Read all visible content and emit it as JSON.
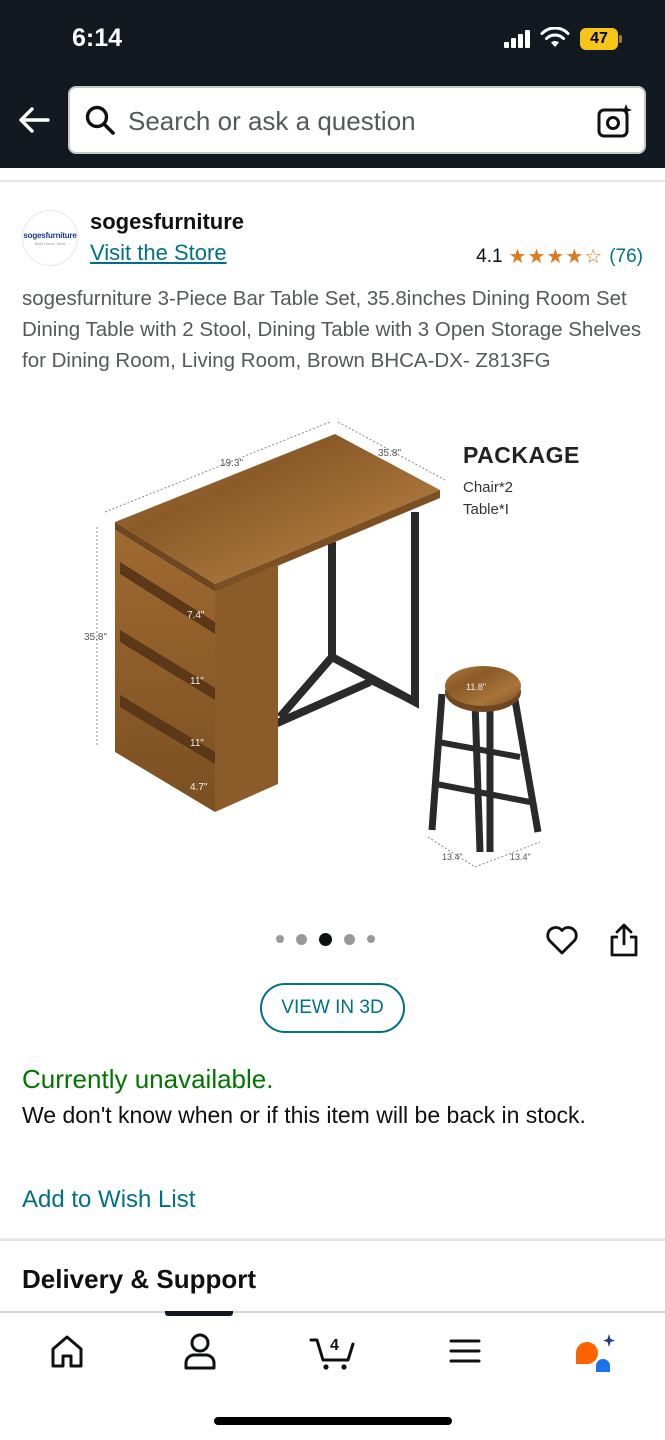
{
  "status_bar": {
    "time": "6:14",
    "battery": "47"
  },
  "search": {
    "placeholder": "Search or ask a question"
  },
  "brand": {
    "logo_text": "sogesfurniture",
    "logo_tagline": "Best Home, Best",
    "name": "sogesfurniture",
    "visit_store": "Visit the Store"
  },
  "rating": {
    "value": "4.1",
    "stars": "★★★★☆",
    "count": "(76)",
    "star_color": "#de7921"
  },
  "product": {
    "title": "sogesfurniture 3-Piece Bar Table Set, 35.8inches Dining Room Set Dining Table with 2 Stool, Dining Table with 3 Open Storage Shelves for Dining Room, Living Room, Brown BHCA-DX- Z813FG"
  },
  "image_labels": {
    "package_title": "PACKAGE",
    "package_line1": "Chair*2",
    "package_line2": "Table*I",
    "dims": {
      "width": "19.3\"",
      "depth": "35.8\"",
      "height": "35.8\"",
      "shelf1": "7.4\"",
      "shelf2": "11\"",
      "shelf3": "11\"",
      "base": "4.7\"",
      "stool_top": "11.8\"",
      "stool_w1": "13.4\"",
      "stool_w2": "13.4\""
    }
  },
  "carousel": {
    "total": 5,
    "active_index": 2
  },
  "actions": {
    "view_3d": "VIEW IN 3D"
  },
  "availability": {
    "status": "Currently unavailable.",
    "note": "We don't know when or if this item will be back in stock.",
    "status_color": "#007600"
  },
  "wishlist": {
    "label": "Add to Wish List"
  },
  "sections": {
    "delivery": "Delivery & Support"
  },
  "bottom_nav": {
    "cart_count": "4"
  },
  "colors": {
    "header_bg": "#131921",
    "link": "#007185",
    "rufus": "#ff6200"
  }
}
